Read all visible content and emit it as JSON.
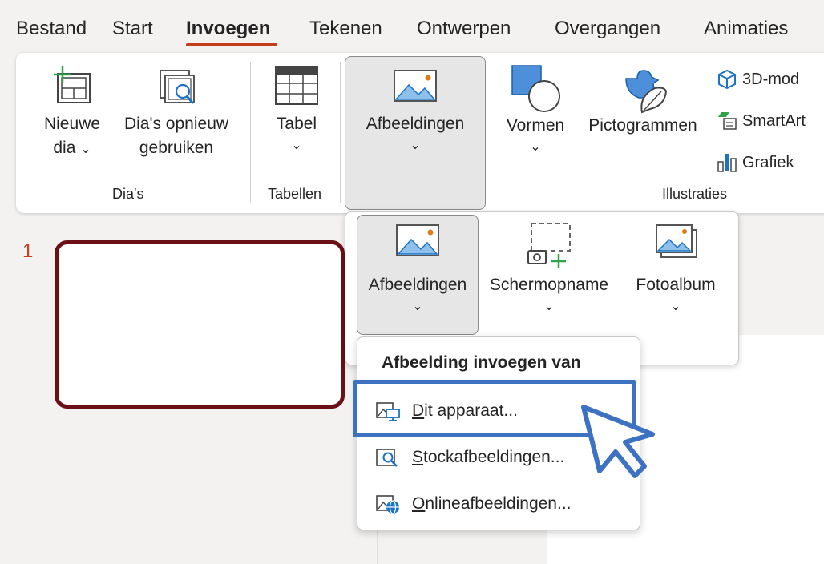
{
  "tabs": [
    {
      "label": "Bestand"
    },
    {
      "label": "Start"
    },
    {
      "label": "Invoegen"
    },
    {
      "label": "Tekenen"
    },
    {
      "label": "Ontwerpen"
    },
    {
      "label": "Overgangen"
    },
    {
      "label": "Animaties"
    }
  ],
  "active_tab": "Invoegen",
  "colors": {
    "accent": "#c43e1c",
    "highlight": "#3d72c2",
    "slide_border": "#6b1016"
  },
  "ribbon": {
    "new_slide": {
      "line1": "Nieuwe",
      "line2": "dia",
      "chevron": "⌄"
    },
    "reuse_slides": {
      "line1": "Dia's opnieuw",
      "line2": "gebruiken"
    },
    "group_slides": "Dia's",
    "table": {
      "label": "Tabel",
      "chevron": "⌄"
    },
    "group_tables": "Tabellen",
    "pictures": {
      "label": "Afbeeldingen",
      "chevron": "⌄"
    },
    "shapes": {
      "label": "Vormen",
      "chevron": "⌄"
    },
    "icons": {
      "label": "Pictogrammen"
    },
    "models3d": {
      "label": "3D-mod"
    },
    "smartart": {
      "label": "SmartArt"
    },
    "chart": {
      "label": "Grafiek"
    },
    "group_illustrations": "Illustraties"
  },
  "submenu": {
    "pictures": {
      "label": "Afbeeldingen",
      "chevron": "⌄"
    },
    "screenshot": {
      "label": "Schermopname",
      "chevron": "⌄"
    },
    "photo_album": {
      "label": "Fotoalbum",
      "chevron": "⌄"
    }
  },
  "flyout": {
    "header": "Afbeelding invoegen van",
    "items": [
      {
        "label": "Dit apparaat...",
        "icon": "this-device-icon"
      },
      {
        "label": "Stockafbeeldingen...",
        "icon": "stock-images-icon"
      },
      {
        "label": "Onlineafbeeldingen...",
        "icon": "online-images-icon"
      }
    ]
  },
  "slide_panel": {
    "number": "1"
  }
}
